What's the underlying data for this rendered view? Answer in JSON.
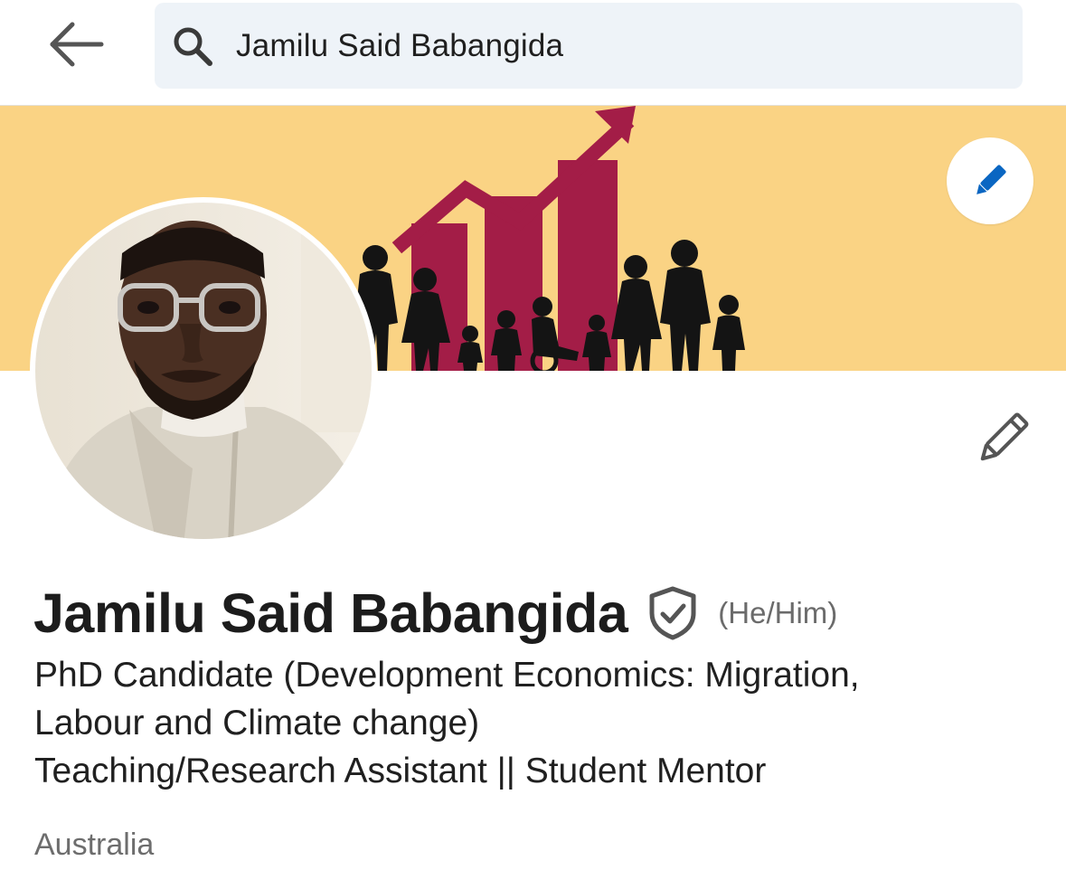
{
  "search": {
    "query": "Jamilu Said Babangida"
  },
  "icons": {
    "back": "arrow-left-icon",
    "search": "search-icon",
    "cover_edit": "pencil-icon",
    "intro_edit": "pencil-icon",
    "verified": "shield-check-icon"
  },
  "colors": {
    "cover_background": "#fad384",
    "cover_graphic": "#a31d47",
    "accent_blue": "#0a66c2",
    "search_background": "#eef3f8"
  },
  "profile": {
    "name": "Jamilu Said Babangida",
    "pronouns": "(He/Him)",
    "headline_lines": [
      "PhD Candidate (Development Economics: Migration,",
      "Labour and Climate change)",
      "Teaching/Research Assistant || Student Mentor"
    ],
    "location": "Australia"
  }
}
